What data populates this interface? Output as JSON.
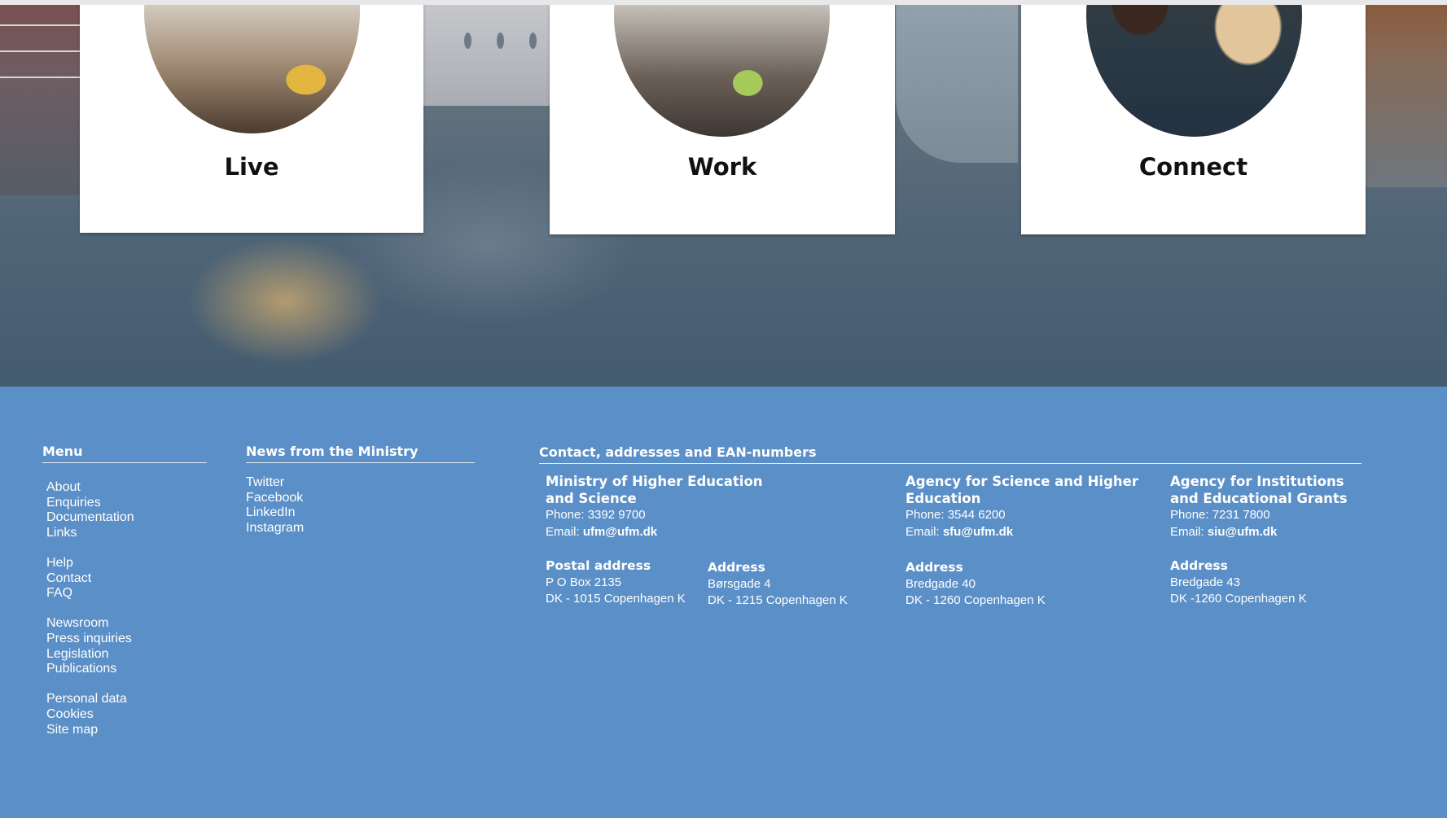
{
  "cards": [
    {
      "id": "live",
      "title": "Live",
      "image": "apartment-living-room-photo"
    },
    {
      "id": "work",
      "title": "Work",
      "image": "meeting-room-photo"
    },
    {
      "id": "connect",
      "title": "Connect",
      "image": "group-selfie-photo"
    }
  ],
  "footer": {
    "menu": {
      "heading": "Menu",
      "groups": [
        [
          "About",
          "Enquiries",
          "Documentation",
          "Links"
        ],
        [
          "Help",
          "Contact",
          "FAQ"
        ],
        [
          "Newsroom",
          "Press inquiries",
          "Legislation",
          "Publications"
        ],
        [
          "Personal data",
          "Cookies",
          "Site map"
        ]
      ]
    },
    "news": {
      "heading": "News from the Ministry",
      "items": [
        "Twitter",
        "Facebook",
        "LinkedIn",
        "Instagram"
      ]
    },
    "contact": {
      "heading": "Contact, addresses and EAN-numbers",
      "ministry": {
        "name_line1": "Ministry of Higher Education",
        "name_line2": "and Science",
        "phone": "Phone: 3392 9700",
        "email_label": "Email: ",
        "email": "ufm@ufm.dk",
        "postal_label": "Postal address",
        "postal_line1": "P O Box 2135",
        "postal_line2": "DK - 1015 Copenhagen K",
        "address_label": "Address",
        "address_line1": "Børsgade 4",
        "address_line2": "DK - 1215 Copenhagen K"
      },
      "science_agency": {
        "name_line1": "Agency for Science and Higher",
        "name_line2": "Education",
        "phone": "Phone: 3544 6200",
        "email_label": "Email: ",
        "email": "sfu@ufm.dk",
        "address_label": "Address",
        "address_line1": "Bredgade 40",
        "address_line2": "DK - 1260 Copenhagen K"
      },
      "institutions_agency": {
        "name_line1": "Agency for Institutions",
        "name_line2": "and Educational Grants",
        "phone": "Phone: 7231 7800",
        "email_label": "Email: ",
        "email": "siu@ufm.dk",
        "address_label": "Address",
        "address_line1": "Bredgade 43",
        "address_line2": "DK -1260 Copenhagen K"
      }
    }
  },
  "colors": {
    "footer_bg": "#5b8fc7",
    "card_bg": "#ffffff",
    "text_dark": "#111111",
    "text_light": "#ffffff"
  }
}
